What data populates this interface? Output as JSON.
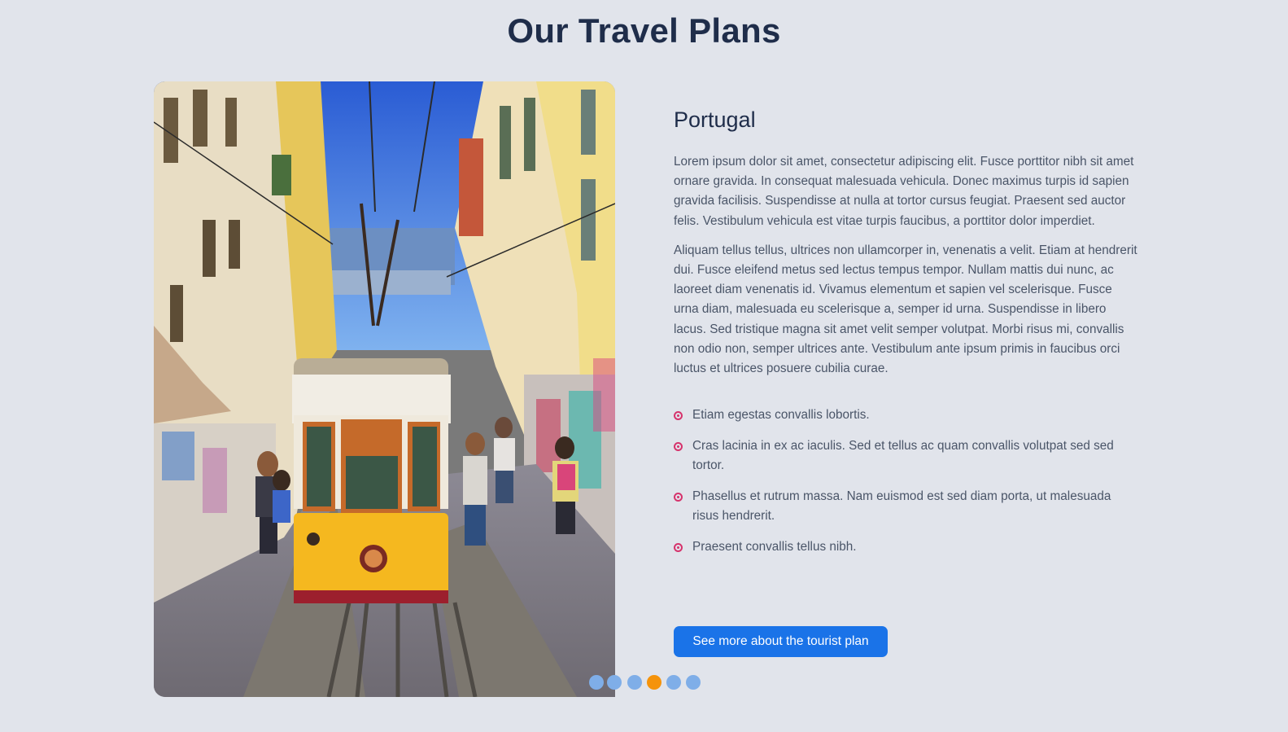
{
  "page": {
    "title": "Our Travel Plans"
  },
  "slide": {
    "image_alt": "Yellow tram on a narrow street in Lisbon, Portugal",
    "destination": "Portugal",
    "paragraphs": [
      "Lorem ipsum dolor sit amet, consectetur adipiscing elit. Fusce porttitor nibh sit amet ornare gravida. In consequat malesuada vehicula. Donec maximus turpis id sapien gravida facilisis. Suspendisse at nulla at tortor cursus feugiat. Praesent sed auctor felis. Vestibulum vehicula est vitae turpis faucibus, a porttitor dolor imperdiet.",
      "Aliquam tellus tellus, ultrices non ullamcorper in, venenatis a velit. Etiam at hendrerit dui. Fusce eleifend metus sed lectus tempus tempor. Nullam mattis dui nunc, ac laoreet diam venenatis id. Vivamus elementum et sapien vel scelerisque. Fusce urna diam, malesuada eu scelerisque a, semper id urna. Suspendisse in libero lacus. Sed tristique magna sit amet velit semper volutpat. Morbi risus mi, convallis non odio non, semper ultrices ante. Vestibulum ante ipsum primis in faucibus orci luctus et ultrices posuere cubilia curae."
    ],
    "features": [
      "Etiam egestas convallis lobortis.",
      "Cras lacinia in ex ac iaculis. Sed et tellus ac quam convallis volutpat sed sed tortor.",
      "Phasellus et rutrum massa. Nam euismod est sed diam porta, ut malesuada risus hendrerit.",
      "Praesent convallis tellus nibh."
    ],
    "button_label": "See more about the tourist plan"
  },
  "carousel": {
    "slide_count": 6,
    "active_index": 3
  },
  "colors": {
    "background": "#e1e4eb",
    "title": "#1f2d4a",
    "button": "#1a73e8",
    "bullet": "#d6336c",
    "dot": "#7faee8",
    "dot_active": "#f5930b"
  }
}
